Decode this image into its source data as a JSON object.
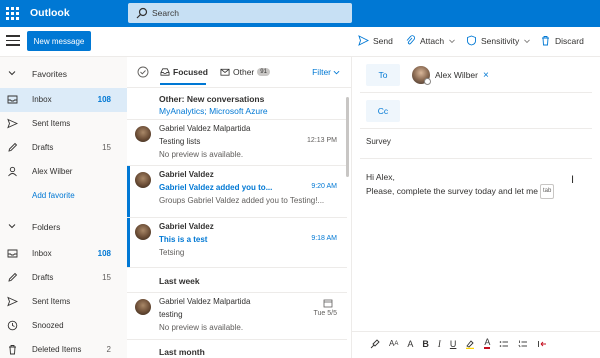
{
  "app": {
    "title": "Outlook"
  },
  "search": {
    "placeholder": "Search"
  },
  "toolbar": {
    "new_message": "New message",
    "send": "Send",
    "attach": "Attach",
    "sensitivity": "Sensitivity",
    "discard": "Discard"
  },
  "nav": {
    "favorites_label": "Favorites",
    "favorites": [
      {
        "label": "Inbox",
        "count": "108",
        "icon": "inbox-icon",
        "selected": true
      },
      {
        "label": "Sent Items",
        "count": "",
        "icon": "send-icon"
      },
      {
        "label": "Drafts",
        "count": "15",
        "icon": "pencil-icon"
      },
      {
        "label": "Alex Wilber",
        "count": "",
        "icon": "person-icon"
      }
    ],
    "add_favorite": "Add favorite",
    "folders_label": "Folders",
    "folders": [
      {
        "label": "Inbox",
        "count": "108",
        "icon": "inbox-icon"
      },
      {
        "label": "Drafts",
        "count": "15",
        "icon": "pencil-icon"
      },
      {
        "label": "Sent Items",
        "count": "",
        "icon": "send-icon"
      },
      {
        "label": "Snoozed",
        "count": "",
        "icon": "clock-icon"
      },
      {
        "label": "Deleted Items",
        "count": "2",
        "icon": "trash-icon"
      }
    ]
  },
  "list": {
    "tab_focused": "Focused",
    "tab_other": "Other",
    "other_badge": "91",
    "filter": "Filter",
    "other_conversations": {
      "title": "Other: New conversations",
      "senders": "MyAnalytics; Microsoft Azure"
    },
    "messages": [
      {
        "from": "Gabriel Valdez Malpartida",
        "subject": "Testing lists",
        "preview": "No preview is available.",
        "time": "12:13 PM",
        "unread": false
      },
      {
        "from": "Gabriel Valdez",
        "subject": "Gabriel Valdez added you to...",
        "preview": "Groups Gabriel Valdez added you to Testing!...",
        "time": "9:20 AM",
        "unread": true
      },
      {
        "from": "Gabriel Valdez",
        "subject": "This is a test",
        "preview": "Tetsing",
        "time": "9:18 AM",
        "unread": true
      }
    ],
    "group_last_week": "Last week",
    "last_week_messages": [
      {
        "from": "Gabriel Valdez Malpartida",
        "subject": "testing",
        "preview": "No preview is available.",
        "time": "Tue 5/5",
        "unread": false
      }
    ],
    "group_last_month": "Last month"
  },
  "compose": {
    "to_label": "To",
    "recipient": "Alex Wilber",
    "cc_label": "Cc",
    "subject": "Survey",
    "body_line1": "Hi Alex,",
    "body_line2": "Please, complete the survey today and let me",
    "tab_hint": "tab"
  },
  "colors": {
    "accent": "#0078d4",
    "selected": "#dcebf8",
    "search_bg": "#c7e0f4"
  }
}
